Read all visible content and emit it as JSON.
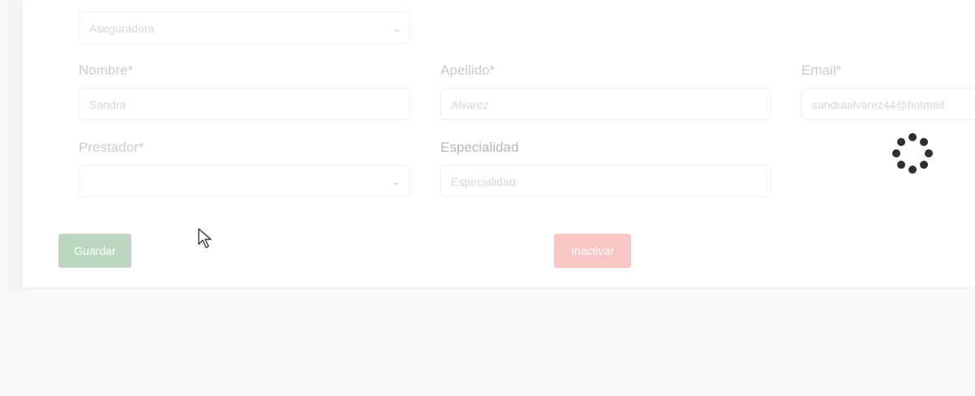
{
  "insurer": {
    "placeholder": "Aseguradora"
  },
  "form": {
    "nombre_label": "Nombre*",
    "nombre_value": "Sandra",
    "apellido_label": "Apellido*",
    "apellido_value": "Alvarez",
    "email_label": "Email*",
    "email_value": "sandraalvarez44@hotmail.",
    "prestador_label": "Prestador*",
    "prestador_value": "",
    "especialidad_label": "Especialidad",
    "especialidad_placeholder": "Especialidad"
  },
  "actions": {
    "save_label": "Guardar",
    "inactivate_label": "Inactivar"
  },
  "icons": {
    "dropdown": "chevron-down-icon",
    "loading": "loading-spinner-icon",
    "cursor": "mouse-pointer-icon"
  },
  "colors": {
    "save_button": "#b9d8bf",
    "inactivate_button": "#f8c6c4",
    "spinner": "#333333"
  }
}
